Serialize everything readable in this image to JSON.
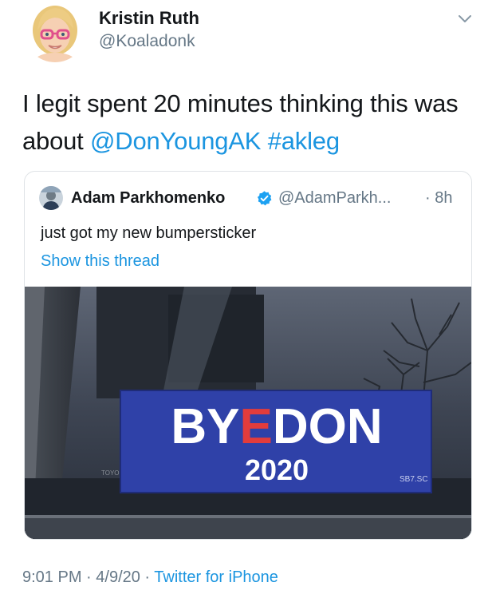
{
  "author": {
    "display_name": "Kristin Ruth",
    "handle": "@Koaladonk"
  },
  "tweet": {
    "text_prefix": "I legit spent 20 minutes thinking this was about ",
    "mention": "@DonYoungAK",
    "space": " ",
    "hashtag": "#akleg"
  },
  "quoted_tweet": {
    "display_name": "Adam Parkhomenko",
    "handle": "@AdamParkh...",
    "time": "· 8h",
    "text": "just got my new bumpersticker",
    "show_thread": "Show this thread"
  },
  "media": {
    "sticker_line1_a": "BY",
    "sticker_line1_b": "E",
    "sticker_line1_c": "DON",
    "sticker_line2": "2020",
    "sticker_corner": "SB7.SC",
    "car_text": "TOYO"
  },
  "footer": {
    "time": "9:01 PM",
    "sep1": " · ",
    "date": "4/9/20",
    "sep2": " · ",
    "source": "Twitter for iPhone"
  },
  "colors": {
    "link": "#1b95e0",
    "secondary": "#657786",
    "sticker_blue": "#2d3fa6",
    "sticker_red": "#e23c3c",
    "verified": "#1da1f2"
  },
  "icons": {
    "chevron": "chevron-down-icon",
    "verified": "verified-badge-icon"
  }
}
